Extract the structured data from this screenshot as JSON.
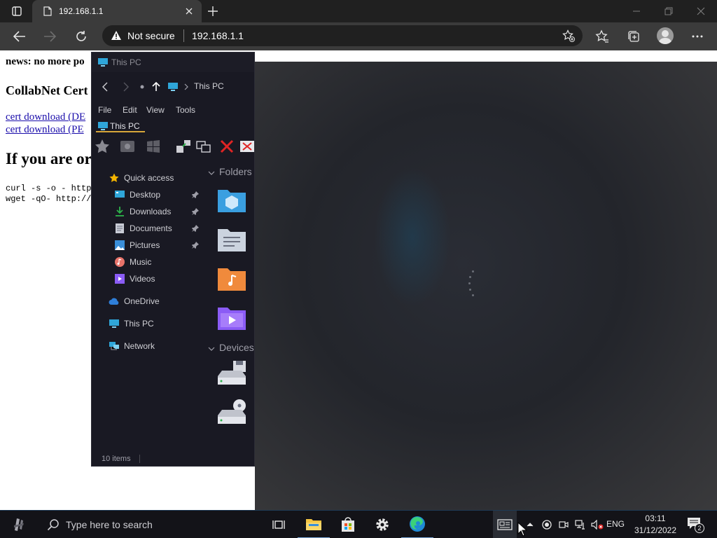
{
  "browser": {
    "tab_title": "192.168.1.1",
    "address": {
      "security_label": "Not secure",
      "url": "192.168.1.1"
    }
  },
  "webpage": {
    "news": "news: no more po",
    "heading2": "CollabNet Cert",
    "links": [
      "cert download (DE",
      "cert download (PE"
    ],
    "heading1": "If you are or",
    "code_lines": [
      "curl -s -o - http",
      "wget -qO- http://"
    ]
  },
  "explorer": {
    "title": "This PC",
    "breadcrumb": "This PC",
    "menu": [
      "File",
      "Edit",
      "View",
      "Tools"
    ],
    "tab_label": "This PC",
    "nav": {
      "quick_access": "Quick access",
      "pinned": [
        "Desktop",
        "Downloads",
        "Documents",
        "Pictures"
      ],
      "unpinned": [
        "Music",
        "Videos"
      ],
      "onedrive": "OneDrive",
      "this_pc": "This PC",
      "network": "Network"
    },
    "sections": {
      "folders": "Folders",
      "devices": "Devices"
    },
    "status": "10 items"
  },
  "taskbar": {
    "search_placeholder": "Type here to search",
    "language": "ENG",
    "time": "03:11",
    "date": "31/12/2022",
    "notification_count": "2"
  },
  "colors": {
    "accent": "#d7a73a",
    "explorer_bg": "#191923",
    "taskbar_bg": "#131318",
    "link": "#1a0dab"
  }
}
